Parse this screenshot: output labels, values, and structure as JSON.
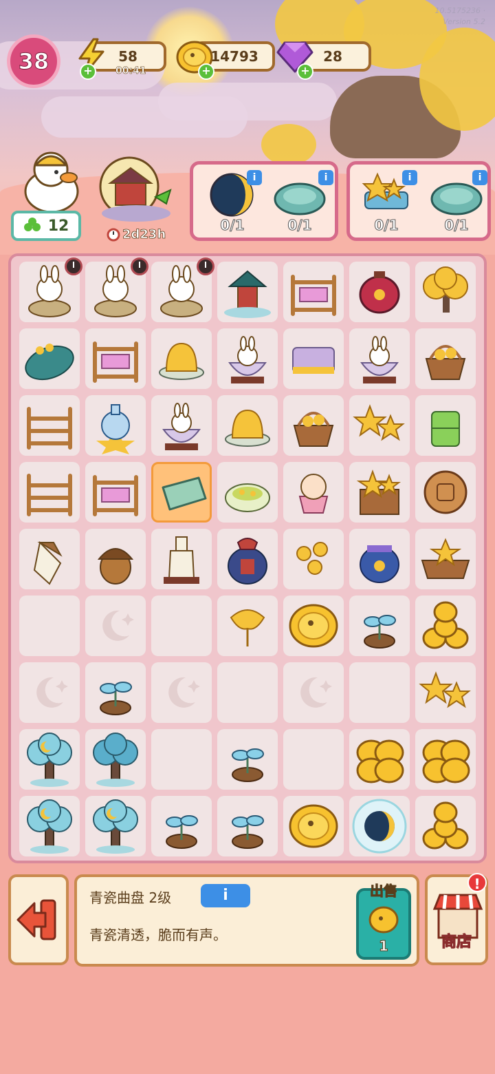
{
  "header": {
    "build_info": "10.5175236 · Version 5.2",
    "level": "38",
    "energy": {
      "value": "58",
      "timer": "00:41",
      "icon": "lightning-icon"
    },
    "coins": {
      "value": "14793",
      "icon": "coin-icon"
    },
    "gems": {
      "value": "28",
      "icon": "gem-icon"
    }
  },
  "character": {
    "leaf_count": "12",
    "event_timer": "2d23h"
  },
  "orders": [
    {
      "items": [
        {
          "name": "crescent-moon",
          "count": "0/1"
        },
        {
          "name": "celadon-dish",
          "count": "0/1"
        }
      ]
    },
    {
      "items": [
        {
          "name": "star-cookies",
          "count": "0/1"
        },
        {
          "name": "celadon-dish",
          "count": "0/1"
        }
      ]
    }
  ],
  "board": {
    "selected_cell": "r3c2",
    "rows": [
      [
        "bunny-mortar-timer",
        "bunny-mortar-timer",
        "bunny-mortar-timer",
        "lantern-pavilion",
        "loom",
        "red-lantern",
        "osmanthus-tree"
      ],
      [
        "leaf-with-flowers",
        "loom",
        "jelly-platter",
        "bunny-bowl",
        "folded-cloth",
        "bunny-bowl",
        "flower-basket"
      ],
      [
        "wooden-rack",
        "vase-on-star",
        "bunny-bowl",
        "jelly-platter",
        "flower-basket",
        "star-cookies",
        "bamboo-cup"
      ],
      [
        "wooden-rack",
        "loom",
        "celadon-dish",
        "tea-bowl",
        "bunny-cupcake",
        "star-cookie-box",
        "mooncake"
      ],
      [
        "bamboo-shoot",
        "acorn",
        "wine-bottle",
        "wine-jar",
        "osmanthus-flower",
        "blue-jar",
        "star-basket"
      ],
      [
        "empty",
        "moon-placeholder",
        "empty",
        "ginkgo-leaf",
        "coin",
        "sprout",
        "coin-pile"
      ],
      [
        "moon-placeholder",
        "sprout",
        "moon-placeholder",
        "empty",
        "moon-placeholder",
        "empty",
        "star-cookies"
      ],
      [
        "moon-tree",
        "blue-tree",
        "empty",
        "sprout",
        "empty",
        "coin-stack",
        "coin-stack"
      ],
      [
        "moon-tree",
        "moon-tree",
        "sprout",
        "sprout",
        "coin",
        "moon-bubble",
        "coin-pile"
      ]
    ]
  },
  "bottom": {
    "item_title": "青瓷曲盘 2级",
    "item_desc": "青瓷清透，脆而有声。",
    "info_label": "i",
    "sell_label": "出售",
    "sell_amount": "1",
    "shop_label": "商店",
    "shop_alert": "!"
  }
}
